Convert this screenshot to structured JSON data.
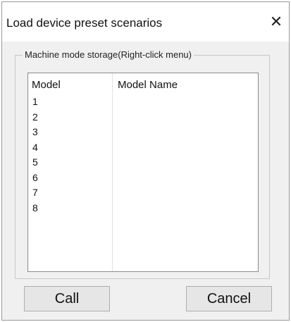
{
  "window": {
    "title": "Load device preset scenarios",
    "close_glyph": "✕",
    "close_icon": "close-icon"
  },
  "group": {
    "label": "Machine mode storage(Right-click menu)"
  },
  "table": {
    "columns": [
      "Model",
      "Model Name"
    ],
    "rows": [
      {
        "model": "1",
        "name": ""
      },
      {
        "model": "2",
        "name": ""
      },
      {
        "model": "3",
        "name": ""
      },
      {
        "model": "4",
        "name": ""
      },
      {
        "model": "5",
        "name": ""
      },
      {
        "model": "6",
        "name": ""
      },
      {
        "model": "7",
        "name": ""
      },
      {
        "model": "8",
        "name": ""
      },
      {
        "model": "",
        "name": ""
      },
      {
        "model": "",
        "name": ""
      },
      {
        "model": "",
        "name": ""
      }
    ]
  },
  "buttons": {
    "call_label": "Call",
    "cancel_label": "Cancel"
  }
}
